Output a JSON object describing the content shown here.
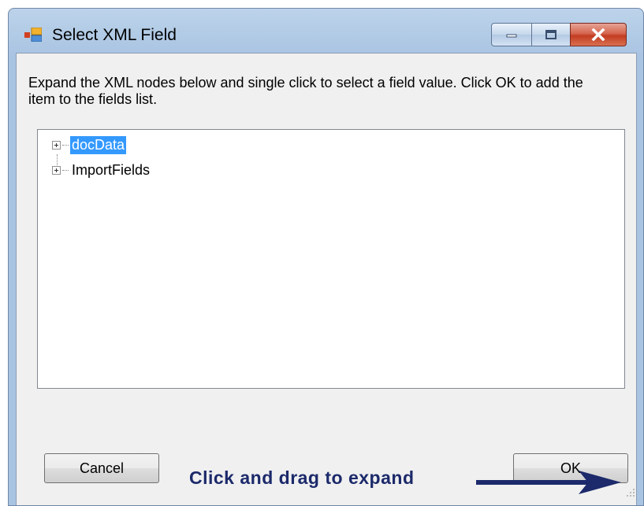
{
  "window": {
    "title": "Select XML Field",
    "controls": [
      "minimize",
      "maximize",
      "close"
    ]
  },
  "instruction": "Expand the XML nodes below and single click to select a field value.  Click OK to add the item to the fields list.",
  "tree": {
    "nodes": [
      {
        "label": "docData",
        "selected": true,
        "expander": "plus"
      },
      {
        "label": "ImportFields",
        "selected": false,
        "expander": "plus"
      }
    ]
  },
  "buttons": {
    "cancel": "Cancel",
    "ok": "OK"
  },
  "annotation": {
    "text": "Click and drag to expand"
  },
  "colors": {
    "selection": "#3399ff",
    "annotation": "#1c2a6b",
    "frame": "#a9c4e2",
    "close_button": "#c23b22"
  }
}
